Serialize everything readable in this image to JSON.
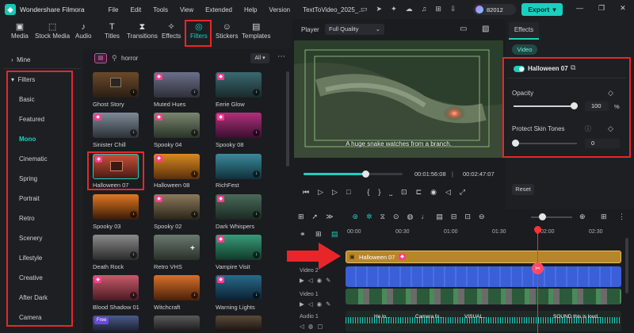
{
  "app": {
    "title": "Wondershare Filmora",
    "menu": [
      "File",
      "Edit",
      "Tools",
      "View",
      "Extended",
      "Help",
      "Version"
    ],
    "project": "TextToVideo_2025_...",
    "credits": "82012",
    "export_label": "Export"
  },
  "toolbar": {
    "tools": [
      {
        "label": "Media",
        "icon": "media-icon"
      },
      {
        "label": "Stock Media",
        "icon": "stock-media-icon"
      },
      {
        "label": "Audio",
        "icon": "audio-icon"
      },
      {
        "label": "Titles",
        "icon": "titles-icon"
      },
      {
        "label": "Transitions",
        "icon": "transitions-icon"
      },
      {
        "label": "Effects",
        "icon": "effects-icon"
      },
      {
        "label": "Filters",
        "icon": "filters-icon"
      },
      {
        "label": "Stickers",
        "icon": "stickers-icon"
      },
      {
        "label": "Templates",
        "icon": "templates-icon"
      }
    ],
    "active": "Filters"
  },
  "sidebar": {
    "mine": "Mine",
    "filters": "Filters",
    "items": [
      "Basic",
      "Featured",
      "Mono",
      "Cinematic",
      "Spring",
      "Portrait",
      "Retro",
      "Scenery",
      "Lifestyle",
      "Creative",
      "After Dark",
      "Camera"
    ],
    "active": "Mono"
  },
  "search": {
    "query": "horror",
    "filter_label": "All"
  },
  "filters_grid": [
    {
      "label": "Ghost Story"
    },
    {
      "label": "Muted Hues"
    },
    {
      "label": "Eerie Glow"
    },
    {
      "label": "Sinister Chill"
    },
    {
      "label": "Spooky 04"
    },
    {
      "label": "Spooky 08"
    },
    {
      "label": "Halloween 07"
    },
    {
      "label": "Halloween 08"
    },
    {
      "label": "RichFest"
    },
    {
      "label": "Spooky 03"
    },
    {
      "label": "Spooky 02"
    },
    {
      "label": "Dark Whispers"
    },
    {
      "label": "Death Rock"
    },
    {
      "label": "Retro VHS"
    },
    {
      "label": "Vampire Visit"
    },
    {
      "label": "Blood Shadow 01"
    },
    {
      "label": "Witchcraft"
    },
    {
      "label": "Warning Lights"
    }
  ],
  "free_badge": "Free",
  "player": {
    "label": "Player",
    "quality": "Full Quality",
    "caption": "A huge snake watches from a branch.",
    "current_time": "00:01:56:08",
    "total_time": "00:02:47:07",
    "progress": 0.62
  },
  "effects_panel": {
    "tab": "Effects",
    "subtab": "Video",
    "filter_name": "Halloween 07",
    "opacity_label": "Opacity",
    "opacity_value": "100",
    "opacity_unit": "%",
    "skin_label": "Protect Skin Tones",
    "skin_value": "0",
    "reset_label": "Reset"
  },
  "timeline": {
    "ruler": [
      "00:00",
      "00:30",
      "01:00",
      "01:30",
      "02:00",
      "02:30"
    ],
    "tracks": [
      "Video 2",
      "Video 1",
      "Audio 1"
    ],
    "filter_clip": "Halloween 07",
    "audio_snippets": [
      "He lo...",
      "Camera fo...",
      "VISUAL...",
      "SOUND this is loud..."
    ]
  },
  "colors": {
    "accent": "#19d1c0",
    "highlight": "#e8262a",
    "clip_gold": "#b8862a",
    "clip_blue": "#3a5fd8"
  }
}
